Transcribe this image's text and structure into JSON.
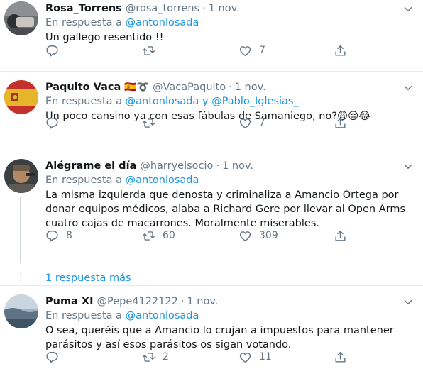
{
  "tweets": [
    {
      "name": "Rosa_Torrens",
      "handle": "@rosa_torrens",
      "sep": "·",
      "time": "1 nov.",
      "reply_prefix": "En respuesta a",
      "reply_to": "@antonlosada",
      "text": "Un gallego resentido !!",
      "likes": "7"
    },
    {
      "name": "Paquito Vaca",
      "flag": "🇪🇸➰",
      "handle": "@VacaPaquito",
      "sep": "·",
      "time": "1 nov.",
      "reply_prefix": "En respuesta a",
      "reply_to": "@antonlosada",
      "reply_and": "y",
      "reply_to2": "@Pablo_Iglesias_",
      "text": "Un poco cansino ya con esas fábulas de Samaniego, no?😩😔😂",
      "likes": "7"
    },
    {
      "name": "Alégrame el día",
      "handle": "@harryelsocio",
      "sep": "·",
      "time": "1 nov.",
      "reply_prefix": "En respuesta a",
      "reply_to": "@antonlosada",
      "text": "La misma izquierda que denosta y criminaliza a Amancio Ortega por donar equipos médicos, alaba a Richard Gere por llevar al Open Arms cuatro cajas de macarrones. Moralmente miserables.",
      "replies": "8",
      "retweets": "60",
      "likes": "309",
      "more_replies": "1 respuesta más"
    },
    {
      "name": "Puma XI",
      "handle": "@Pepe4122122",
      "sep": "·",
      "time": "1 nov.",
      "reply_prefix": "En respuesta a",
      "reply_to": "@antonlosada",
      "text": "O sea, queréis que a Amancio lo crujan a impuestos para mantener parásitos y así esos parásitos os sigan votando.",
      "retweets": "2",
      "likes": "11"
    }
  ],
  "colors": {
    "text": "#14171a",
    "secondary": "#657786",
    "link": "#1b95e0",
    "border": "#e6ecf0",
    "thread": "#ccd6dd"
  },
  "icons": [
    "reply-icon",
    "retweet-icon",
    "like-icon",
    "share-icon",
    "chevron-down-icon"
  ]
}
